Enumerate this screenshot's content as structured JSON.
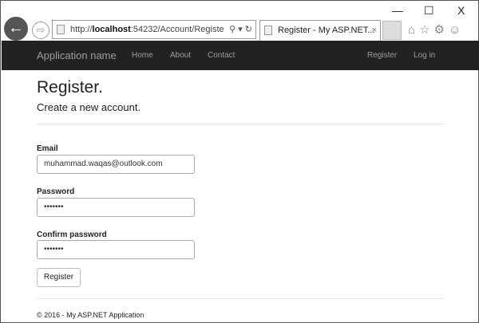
{
  "browser": {
    "url_prefix": "http://",
    "url_host": "localhost",
    "url_rest": ":54232/Account/Registe",
    "tab_title": "Register - My ASP.NET...",
    "close_tab": "×",
    "minimize": "—",
    "maximize": "☐",
    "close": "X"
  },
  "navbar": {
    "brand": "Application name",
    "links": [
      "Home",
      "About",
      "Contact"
    ],
    "right_links": [
      "Register",
      "Log in"
    ]
  },
  "page": {
    "title": "Register.",
    "subtitle": "Create a new account.",
    "fields": [
      {
        "label": "Email",
        "value": "muhammad.waqas@outlook.com"
      },
      {
        "label": "Password",
        "value": "•••••••"
      },
      {
        "label": "Confirm password",
        "value": "•••••••"
      }
    ],
    "submit": "Register"
  },
  "footer": "© 2016 - My ASP.NET Application"
}
